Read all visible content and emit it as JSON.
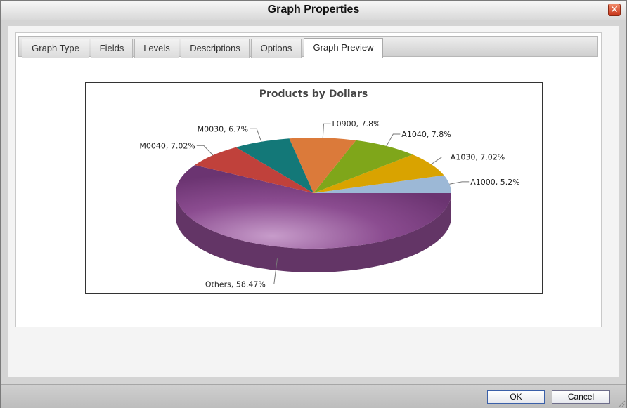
{
  "window": {
    "title": "Graph Properties"
  },
  "tabs": [
    {
      "label": "Graph Type"
    },
    {
      "label": "Fields"
    },
    {
      "label": "Levels"
    },
    {
      "label": "Descriptions"
    },
    {
      "label": "Options"
    },
    {
      "label": "Graph Preview",
      "active": true
    }
  ],
  "buttons": {
    "ok": "OK",
    "cancel": "Cancel"
  },
  "chart_data": {
    "type": "pie",
    "title": "Products by Dollars",
    "slices": [
      {
        "label": "Others, 58.47%",
        "name": "Others",
        "value": 58.47,
        "color": "#8a4a8e"
      },
      {
        "label": "A1000, 5.2%",
        "name": "A1000",
        "value": 5.2,
        "color": "#9cb8d6"
      },
      {
        "label": "A1030, 7.02%",
        "name": "A1030",
        "value": 7.02,
        "color": "#d9a300"
      },
      {
        "label": "A1040, 7.8%",
        "name": "A1040",
        "value": 7.8,
        "color": "#7fa61a"
      },
      {
        "label": "L0900, 7.8%",
        "name": "L0900",
        "value": 7.8,
        "color": "#db7a3a"
      },
      {
        "label": "M0030, 6.7%",
        "name": "M0030",
        "value": 6.7,
        "color": "#137878"
      },
      {
        "label": "M0040, 7.02%",
        "name": "M0040",
        "value": 7.02,
        "color": "#c0413b"
      }
    ],
    "legend": "none",
    "style": "3d-pie"
  }
}
